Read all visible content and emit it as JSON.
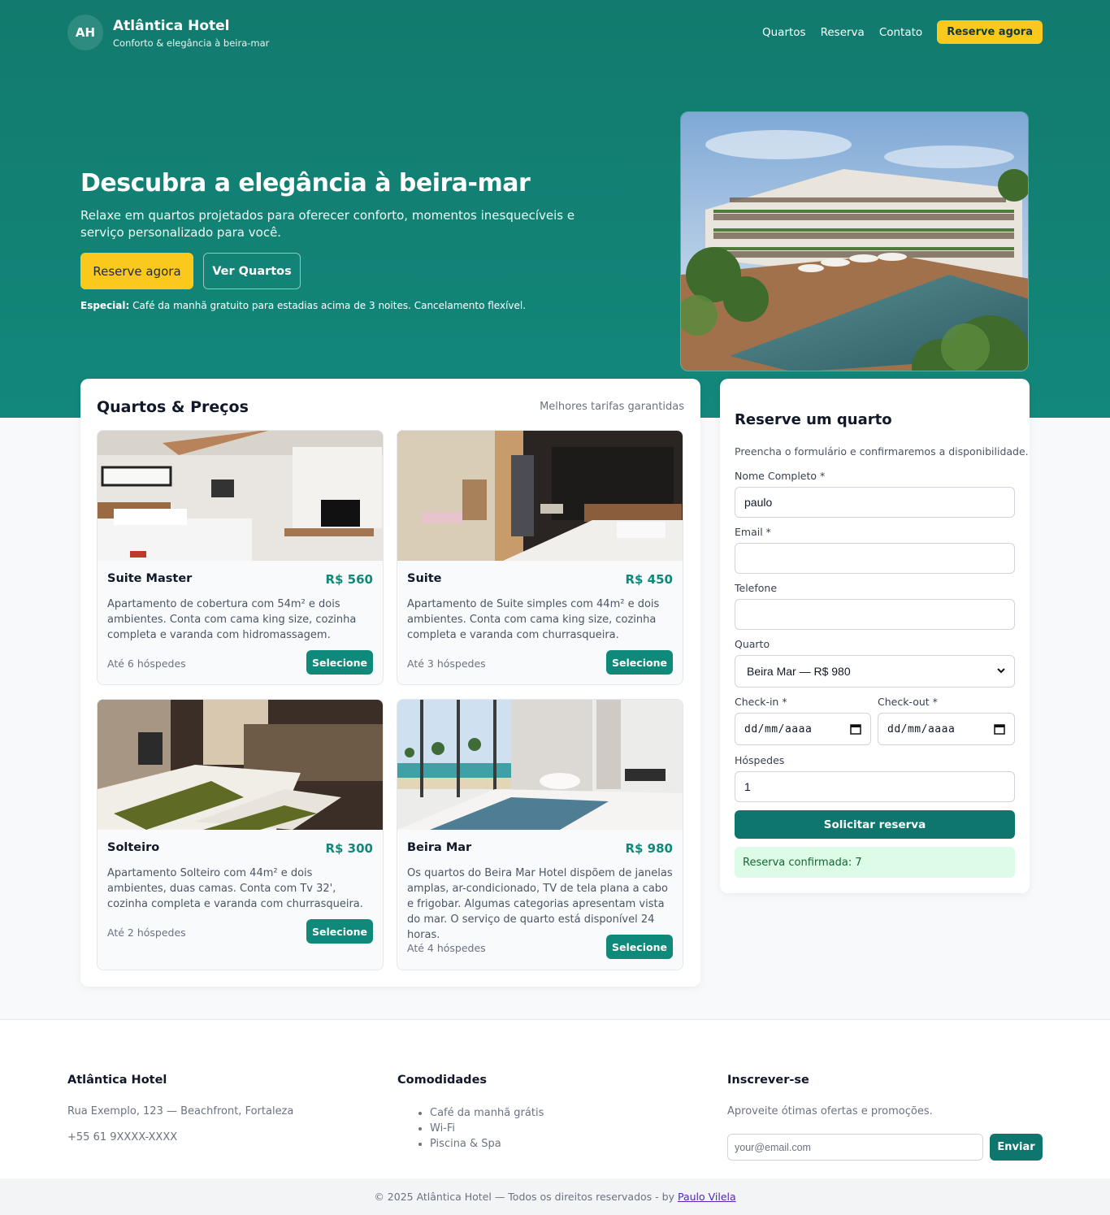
{
  "brand": {
    "initials": "AH",
    "name": "Atlântica Hotel",
    "tagline": "Conforto & elegância à beira-mar"
  },
  "nav": {
    "items": [
      "Quartos",
      "Reserva",
      "Contato"
    ],
    "cta": "Reserve agora"
  },
  "hero": {
    "title": "Descubra a elegância à beira-mar",
    "subtitle": "Relaxe em quartos projetados para oferecer conforto, momentos inesquecíveis e serviço personalizado para você.",
    "primary_button": "Reserve agora",
    "secondary_button": "Ver Quartos",
    "special_label": "Especial:",
    "special_text": "Café da manhã gratuito para estadias acima de 3 noites. Cancelamento flexível."
  },
  "rooms": {
    "title": "Quartos & Preços",
    "note": "Melhores tarifas garantidas",
    "select_label": "Selecione",
    "items": [
      {
        "name": "Suite Master",
        "price": "R$ 560",
        "description": "Apartamento de cobertura com 54m² e dois ambientes. Conta com cama king size, cozinha completa e varanda com hidromassagem.",
        "guests": "Até 6 hóspedes"
      },
      {
        "name": "Suite",
        "price": "R$ 450",
        "description": "Apartamento de Suite simples com 44m² e dois ambientes. Conta com cama king size, cozinha completa e varanda com churrasqueira.",
        "guests": "Até 3 hóspedes"
      },
      {
        "name": "Solteiro",
        "price": "R$ 300",
        "description": "Apartamento Solteiro com 44m² e dois ambientes, duas camas. Conta com Tv 32', cozinha completa e varanda com churrasqueira.",
        "guests": "Até 2 hóspedes"
      },
      {
        "name": "Beira Mar",
        "price": "R$ 980",
        "description": "Os quartos do Beira Mar Hotel dispõem de janelas amplas, ar-condicionado, TV de tela plana a cabo e frigobar. Algumas categorias apresentam vista do mar. O serviço de quarto está disponível 24 horas.",
        "guests": "Até 4 hóspedes"
      }
    ]
  },
  "booking": {
    "title": "Reserve um quarto",
    "subtitle": "Preencha o formulário e confirmaremos a disponibilidade.",
    "name_label": "Nome Completo *",
    "name_value": "paulo",
    "email_label": "Email *",
    "email_value": "",
    "phone_label": "Telefone",
    "phone_value": "",
    "room_label": "Quarto",
    "room_value": "Beira Mar — R$ 980",
    "checkin_label": "Check-in *",
    "checkout_label": "Check-out *",
    "date_placeholder": "dd/mm/aaaa",
    "guests_label": "Hóspedes",
    "guests_value": "1",
    "submit": "Solicitar reserva",
    "confirmation": "Reserva confirmada: 7"
  },
  "footer": {
    "col1": {
      "title": "Atlântica Hotel",
      "address": "Rua Exemplo, 123 — Beachfront, Fortaleza",
      "phone": "+55 61 9XXXX-XXXX"
    },
    "col2": {
      "title": "Comodidades",
      "items": [
        "Café da manhã grátis",
        "Wi-Fi",
        "Piscina & Spa"
      ]
    },
    "col3": {
      "title": "Inscrever-se",
      "text": "Aproveite ótimas ofertas e promoções.",
      "placeholder": "your@email.com",
      "button": "Enviar"
    },
    "copyright": "© 2025 Atlântica Hotel — Todos os direitos reservados - by",
    "author": "Paulo Vilela"
  }
}
